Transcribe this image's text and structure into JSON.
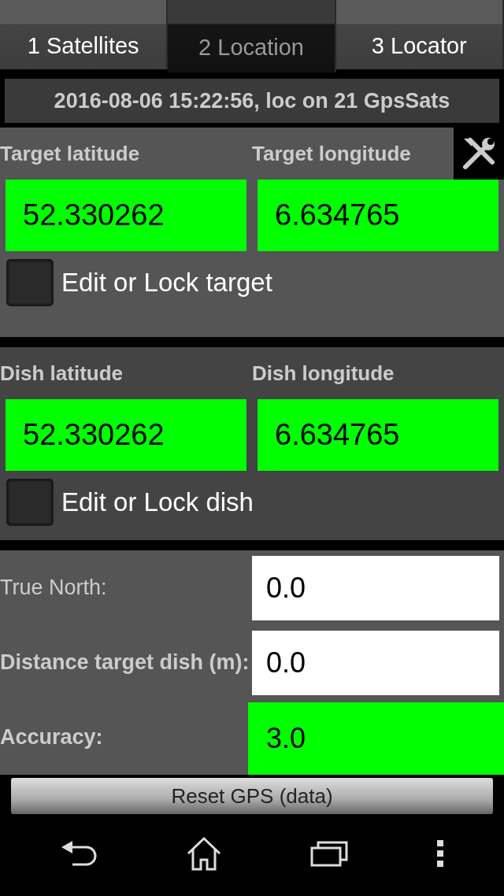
{
  "tabs": [
    {
      "label": "1 Satellites",
      "selected": false
    },
    {
      "label": "2 Location",
      "selected": true
    },
    {
      "label": "3 Locator",
      "selected": false
    }
  ],
  "status": "2016-08-06 15:22:56, loc on 21 GpsSats",
  "target": {
    "lat_label": "Target latitude",
    "lon_label": "Target longitude",
    "lat": "52.330262",
    "lon": "6.634765",
    "lock_label": "Edit or Lock target",
    "checked": false
  },
  "dish": {
    "lat_label": "Dish latitude",
    "lon_label": "Dish longitude",
    "lat": "52.330262",
    "lon": "6.634765",
    "lock_label": "Edit or Lock dish",
    "checked": false
  },
  "readings": [
    {
      "label": "True North:",
      "value": "0.0",
      "kind": "plain"
    },
    {
      "label": "Distance target dish (m):",
      "value": "0.0",
      "kind": "plain"
    },
    {
      "label": "Accuracy:",
      "value": "3.0",
      "kind": "good"
    }
  ],
  "button": "Reset GPS (data)"
}
